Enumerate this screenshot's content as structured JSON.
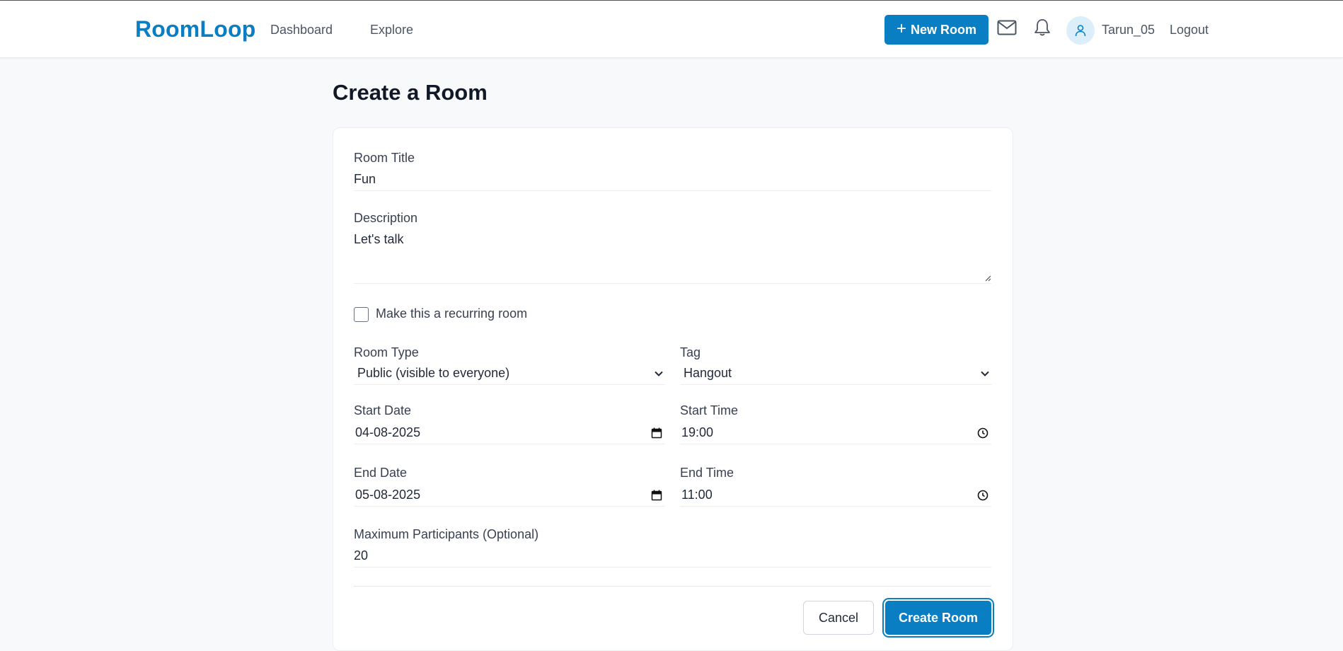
{
  "navbar": {
    "brand": "RoomLoop",
    "links": [
      "Dashboard",
      "Explore"
    ],
    "new_room_label": "New Room",
    "username": "Tarun_05",
    "logout_label": "Logout",
    "icons": [
      "mail-icon",
      "bell-icon",
      "user-icon",
      "plus-icon"
    ]
  },
  "page": {
    "title": "Create a Room"
  },
  "form": {
    "title_label": "Room Title",
    "title_value": "Fun",
    "description_label": "Description",
    "description_value": "Let's talk",
    "recurring_label": "Make this a recurring room",
    "recurring_checked": false,
    "room_type_label": "Room Type",
    "room_type_value": "Public (visible to everyone)",
    "tag_label": "Tag",
    "tag_value": "Hangout",
    "start_date_label": "Start Date",
    "start_date_value": "04-08-2025",
    "start_time_label": "Start Time",
    "start_time_value": "19:00",
    "end_date_label": "End Date",
    "end_date_value": "05-08-2025",
    "end_time_label": "End Time",
    "end_time_value": "11:00",
    "max_participants_label": "Maximum Participants (Optional)",
    "max_participants_value": "20",
    "cancel_label": "Cancel",
    "submit_label": "Create Room"
  },
  "colors": {
    "brand": "#0a7ec2",
    "background": "#f8f9fb",
    "avatar_bg": "#dbeefa"
  }
}
